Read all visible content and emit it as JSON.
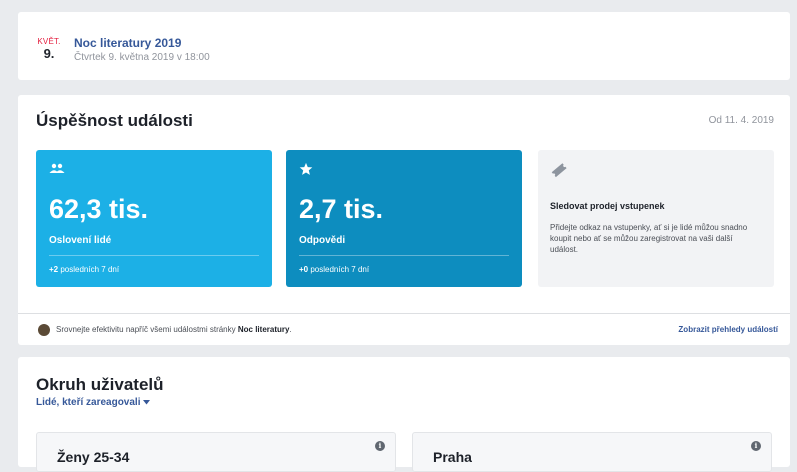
{
  "event": {
    "month": "KVĚT.",
    "day": "9.",
    "title": "Noc literatury 2019",
    "subtitle": "Čtvrtek 9. května 2019 v 18:00"
  },
  "stats": {
    "title": "Úspěšnost události",
    "since": "Od 11. 4. 2019",
    "tiles": [
      {
        "icon": "people-icon",
        "value": "62,3 tis.",
        "label": "Oslovení lidé",
        "delta": "+2",
        "foot": "posledních 7 dní",
        "color": "#1cb0e6"
      },
      {
        "icon": "star-icon",
        "value": "2,7 tis.",
        "label": "Odpovědi",
        "delta": "+0",
        "foot": "posledních 7 dní",
        "color": "#0d8dbf"
      }
    ],
    "tickets": {
      "icon": "ticket-icon",
      "title": "Sledovat prodej vstupenek",
      "text": "Přidejte odkaz na vstupenky, ať si je lidé můžou snadno koupit nebo ať se můžou zaregistrovat na vaši další událost."
    },
    "footer": {
      "text": "Srovnejte efektivitu napříč všemi událostmi stránky",
      "page_name": "Noc literatury",
      "link": "Zobrazit přehledy událostí"
    }
  },
  "audience": {
    "title": "Okruh uživatelů",
    "filter": "Lidé, kteří zareagovali",
    "tiles": [
      {
        "label": "Ženy 25-34"
      },
      {
        "label": "Praha"
      }
    ],
    "info_symbol": "i"
  }
}
